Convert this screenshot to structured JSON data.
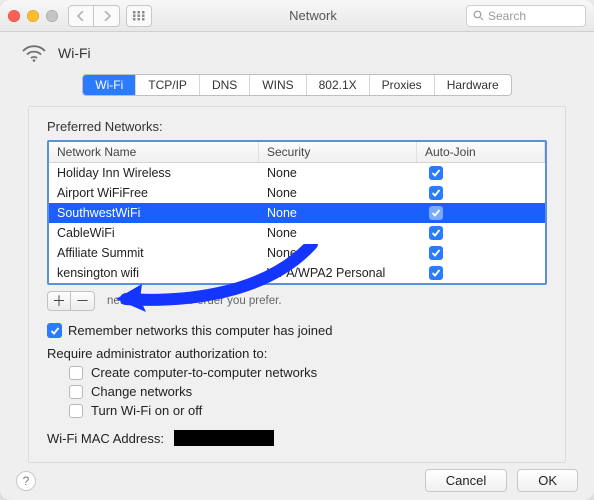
{
  "window": {
    "title": "Network"
  },
  "search": {
    "placeholder": "Search"
  },
  "header": {
    "label": "Wi-Fi"
  },
  "tabs": [
    "Wi-Fi",
    "TCP/IP",
    "DNS",
    "WINS",
    "802.1X",
    "Proxies",
    "Hardware"
  ],
  "active_tab_index": 0,
  "preferred": {
    "label": "Preferred Networks:",
    "cols": {
      "name": "Network Name",
      "security": "Security",
      "auto": "Auto-Join"
    },
    "rows": [
      {
        "name": "Holiday Inn Wireless",
        "security": "None",
        "auto": true,
        "selected": false
      },
      {
        "name": "Airport WiFiFree",
        "security": "None",
        "auto": true,
        "selected": false
      },
      {
        "name": "SouthwestWiFi",
        "security": "None",
        "auto": true,
        "selected": true
      },
      {
        "name": "CableWiFi",
        "security": "None",
        "auto": true,
        "selected": false
      },
      {
        "name": "Affiliate Summit",
        "security": "None",
        "auto": true,
        "selected": false
      },
      {
        "name": "kensington wifi",
        "security": "WPA/WPA2 Personal",
        "auto": true,
        "selected": false
      }
    ],
    "hint": "networks into the order you prefer."
  },
  "remember": {
    "label": "Remember networks this computer has joined",
    "checked": true
  },
  "require": {
    "label": "Require administrator authorization to:",
    "items": [
      {
        "label": "Create computer-to-computer networks",
        "checked": false
      },
      {
        "label": "Change networks",
        "checked": false
      },
      {
        "label": "Turn Wi-Fi on or off",
        "checked": false
      }
    ]
  },
  "mac": {
    "label": "Wi-Fi MAC Address:"
  },
  "buttons": {
    "cancel": "Cancel",
    "ok": "OK",
    "plus": "＋",
    "minus": "－"
  },
  "icons": {
    "help": "?",
    "back": "‹",
    "fwd": "›"
  }
}
